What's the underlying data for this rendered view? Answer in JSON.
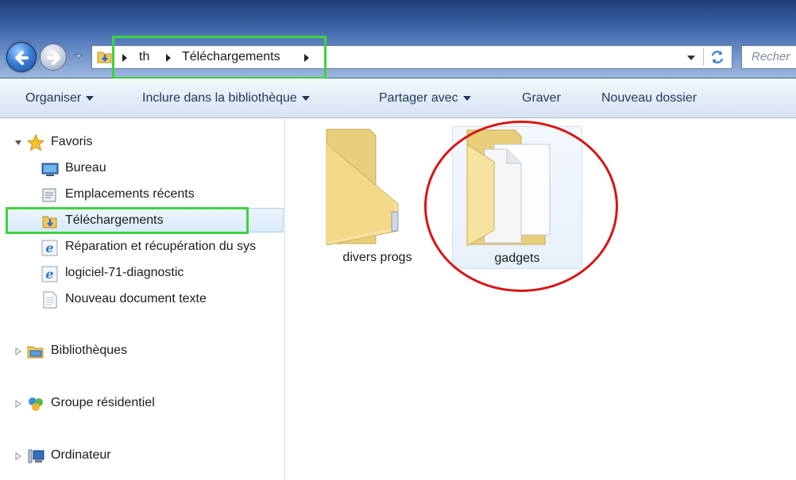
{
  "address_bar": {
    "breadcrumbs": [
      "th",
      "Téléchargements"
    ],
    "folder_icon": "downloads-folder-icon"
  },
  "search": {
    "placeholder": "Recher"
  },
  "toolbar": {
    "organise_label": "Organiser",
    "include_label": "Inclure dans la bibliothèque",
    "share_label": "Partager avec",
    "burn_label": "Graver",
    "new_folder_label": "Nouveau dossier"
  },
  "navigation": {
    "favorites_header": "Favoris",
    "favorites": [
      {
        "label": "Bureau",
        "icon": "desktop-icon"
      },
      {
        "label": "Emplacements récents",
        "icon": "recent-places-icon"
      },
      {
        "label": "Téléchargements",
        "icon": "downloads-folder-icon",
        "selected": true
      },
      {
        "label": "Réparation et récupération du sys",
        "icon": "ie-shortcut-icon"
      },
      {
        "label": "logiciel-71-diagnostic",
        "icon": "ie-shortcut-icon"
      },
      {
        "label": "Nouveau document texte",
        "icon": "text-document-icon"
      }
    ],
    "libraries_label": "Bibliothèques",
    "homegroup_label": "Groupe résidentiel",
    "computer_label": "Ordinateur"
  },
  "content": {
    "items": [
      {
        "name": "divers progs",
        "icon": "folder-icon"
      },
      {
        "name": "gadgets",
        "icon": "folder-with-documents-icon",
        "selected": true
      }
    ]
  },
  "annotations": {
    "highlight_color": "#3fd23f",
    "circle_color": "#d81616"
  }
}
